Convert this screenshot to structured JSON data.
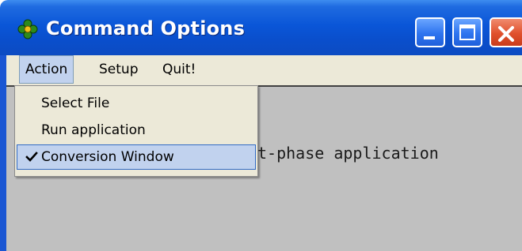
{
  "window": {
    "title": "Command Options",
    "controls": {
      "minimize_icon": "minimize-icon",
      "maximize_icon": "maximize-icon",
      "close_icon": "close-icon"
    },
    "app_icon": "flower-icon"
  },
  "menubar": {
    "items": [
      {
        "label": "Action",
        "active": true
      },
      {
        "label": "Setup",
        "active": false
      },
      {
        "label": "Quit!",
        "active": false
      }
    ]
  },
  "dropdown": {
    "items": [
      {
        "label": "Select File",
        "checked": false
      },
      {
        "label": "Run application",
        "checked": false
      },
      {
        "label": "Conversion Window",
        "checked": true,
        "highlighted": true
      }
    ]
  },
  "client": {
    "text": "t-phase application"
  },
  "colors": {
    "titlebar": "#0a56d8",
    "menubar": "#ece9d8",
    "client": "#c0c0c0",
    "highlight": "#c1d2ee",
    "close_button": "#e0502c"
  }
}
